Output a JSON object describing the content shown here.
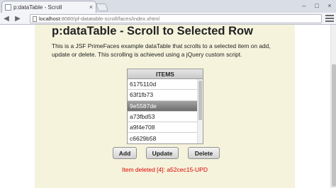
{
  "browser": {
    "tab_title": "p:dataTable - Scroll",
    "tab_close": "×",
    "url_host": "localhost",
    "url_path": ":8080/pf-datatable-scroll/faces/index.xhtml",
    "window_controls": [
      "–",
      "□",
      "×"
    ]
  },
  "page": {
    "title": "p:dataTable - Scroll to Selected Row",
    "description": "This is a JSF PrimeFaces example dataTable that scrolls to a selected item on add, update or delete. This scrolling is achieved using a jQuery custom script."
  },
  "table": {
    "header": "ITEMS",
    "rows": [
      "6175110d",
      "63f1fb73",
      "9e5587de",
      "a73fbd53",
      "a9f4e708",
      "c6629b58"
    ],
    "selected_index": 2
  },
  "actions": {
    "add": "Add",
    "update": "Update",
    "delete": "Delete"
  },
  "message": "Item deleted [4]: a52cec15-UPD",
  "colors": {
    "page_background": "#f5f3dc",
    "message": "#e00000",
    "selected_row": "#6d6d6d"
  }
}
